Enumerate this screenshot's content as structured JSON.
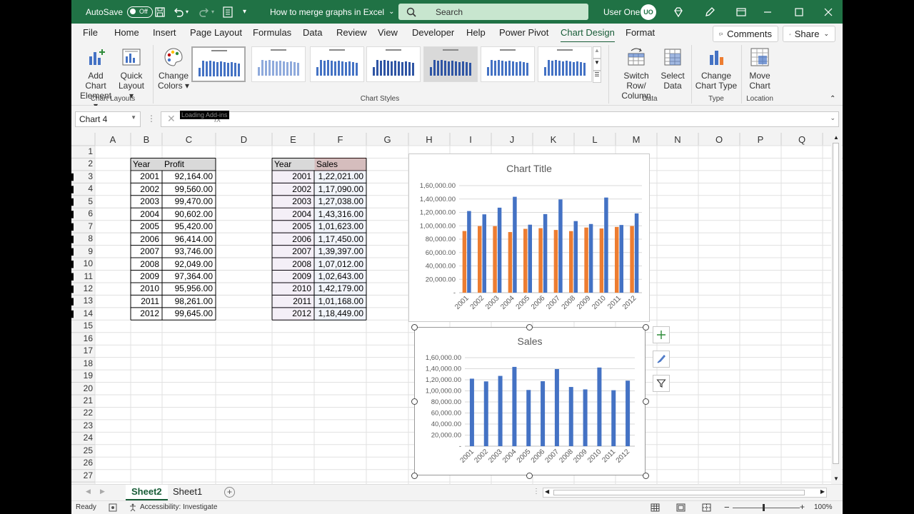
{
  "titlebar": {
    "autosave_label": "AutoSave",
    "autosave_state": "Off",
    "document_title": "How to merge graphs in Excel",
    "search_placeholder": "Search",
    "user_name": "User One",
    "user_initials": "UO"
  },
  "menu_tabs": [
    "File",
    "Home",
    "Insert",
    "Page Layout",
    "Formulas",
    "Data",
    "Review",
    "View",
    "Developer",
    "Help",
    "Power Pivot",
    "Chart Design",
    "Format"
  ],
  "active_tab": "Chart Design",
  "comments_label": "Comments",
  "share_label": "Share",
  "ribbon": {
    "add_chart_element": [
      "Add Chart",
      "Element"
    ],
    "quick_layout": [
      "Quick",
      "Layout"
    ],
    "change_colors": [
      "Change",
      "Colors"
    ],
    "switch_row_column": [
      "Switch Row/",
      "Column"
    ],
    "select_data": [
      "Select",
      "Data"
    ],
    "change_chart_type": [
      "Change",
      "Chart Type"
    ],
    "move_chart": [
      "Move",
      "Chart"
    ],
    "groups": {
      "chart_layouts": "Chart Layouts",
      "chart_styles": "Chart Styles",
      "data": "Data",
      "type": "Type",
      "location": "Location"
    }
  },
  "name_box": "Chart 4",
  "formula_tooltip": "Loading Add-ins",
  "columns": [
    "A",
    "B",
    "C",
    "D",
    "E",
    "F",
    "G",
    "H",
    "I",
    "J",
    "K",
    "L",
    "M",
    "N",
    "O",
    "P",
    "Q"
  ],
  "rows": [
    "1",
    "2",
    "3",
    "4",
    "5",
    "6",
    "7",
    "8",
    "9",
    "10",
    "11",
    "12",
    "13",
    "14",
    "15",
    "16",
    "17",
    "18",
    "19",
    "20",
    "21",
    "22",
    "23",
    "24",
    "25",
    "26",
    "27"
  ],
  "table_profit": {
    "headers": [
      "Year",
      "Profit"
    ],
    "rows": [
      [
        "2001",
        "92,164.00"
      ],
      [
        "2002",
        "99,560.00"
      ],
      [
        "2003",
        "99,470.00"
      ],
      [
        "2004",
        "90,602.00"
      ],
      [
        "2005",
        "95,420.00"
      ],
      [
        "2006",
        "96,414.00"
      ],
      [
        "2007",
        "93,746.00"
      ],
      [
        "2008",
        "92,049.00"
      ],
      [
        "2009",
        "97,364.00"
      ],
      [
        "2010",
        "95,956.00"
      ],
      [
        "2011",
        "98,261.00"
      ],
      [
        "2012",
        "99,645.00"
      ]
    ]
  },
  "table_sales": {
    "headers": [
      "Year",
      "Sales"
    ],
    "rows": [
      [
        "2001",
        "1,22,021.00"
      ],
      [
        "2002",
        "1,17,090.00"
      ],
      [
        "2003",
        "1,27,038.00"
      ],
      [
        "2004",
        "1,43,316.00"
      ],
      [
        "2005",
        "1,01,623.00"
      ],
      [
        "2006",
        "1,17,450.00"
      ],
      [
        "2007",
        "1,39,397.00"
      ],
      [
        "2008",
        "1,07,012.00"
      ],
      [
        "2009",
        "1,02,643.00"
      ],
      [
        "2010",
        "1,42,179.00"
      ],
      [
        "2011",
        "1,01,168.00"
      ],
      [
        "2012",
        "1,18,449.00"
      ]
    ]
  },
  "chart_data": [
    {
      "type": "bar",
      "title": "Chart Title",
      "categories": [
        "2001",
        "2002",
        "2003",
        "2004",
        "2005",
        "2006",
        "2007",
        "2008",
        "2009",
        "2010",
        "2011",
        "2012"
      ],
      "series": [
        {
          "name": "",
          "color": "#ed7d31",
          "values": [
            92164,
            99560,
            99470,
            90602,
            95420,
            96414,
            93746,
            92049,
            97364,
            95956,
            98261,
            99645
          ]
        },
        {
          "name": "",
          "color": "#4472c4",
          "values": [
            122021,
            117090,
            127038,
            143316,
            101623,
            117450,
            139397,
            107012,
            102643,
            142179,
            101168,
            118449
          ]
        }
      ],
      "ylim": [
        0,
        160000
      ],
      "yticks": [
        "-",
        "20,000.00",
        "40,000.00",
        "60,000.00",
        "80,000.00",
        "1,00,000.00",
        "1,20,000.00",
        "1,40,000.00",
        "1,60,000.00"
      ],
      "grid": true
    },
    {
      "type": "bar",
      "title": "Sales",
      "categories": [
        "2001",
        "2002",
        "2003",
        "2004",
        "2005",
        "2006",
        "2007",
        "2008",
        "2009",
        "2010",
        "2011",
        "2012"
      ],
      "series": [
        {
          "name": "",
          "color": "#4472c4",
          "values": [
            122021,
            117090,
            127038,
            143316,
            101623,
            117450,
            139397,
            107012,
            102643,
            142179,
            101168,
            118449
          ]
        }
      ],
      "ylim": [
        0,
        160000
      ],
      "yticks": [
        "-",
        "20,000.00",
        "40,000.00",
        "60,000.00",
        "80,000.00",
        "1,00,000.00",
        "1,20,000.00",
        "1,40,000.00",
        "1,60,000.00"
      ],
      "grid": true
    }
  ],
  "sheets": [
    "Sheet2",
    "Sheet1"
  ],
  "active_sheet": "Sheet2",
  "status": {
    "ready": "Ready",
    "accessibility": "Accessibility: Investigate",
    "zoom": "100%"
  },
  "colors": {
    "excel_green": "#207245",
    "accent": "#185c37",
    "bar_blue": "#4472c4",
    "bar_orange": "#ed7d31"
  }
}
